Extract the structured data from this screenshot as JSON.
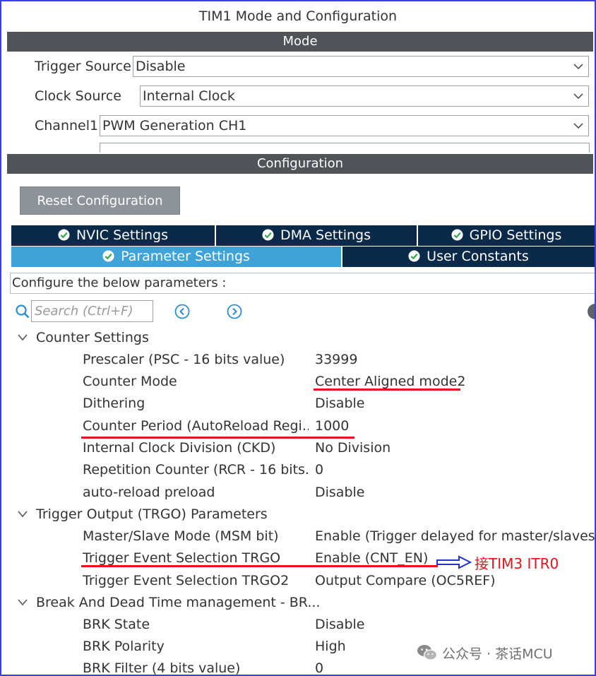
{
  "window": {
    "title": "TIM1 Mode and Configuration"
  },
  "mode": {
    "header": "Mode",
    "fields": [
      {
        "label": "Trigger Source",
        "value": "Disable"
      },
      {
        "label": "Clock Source",
        "value": "Internal Clock"
      },
      {
        "label": "Channel1",
        "value": "PWM Generation CH1"
      }
    ]
  },
  "configuration": {
    "header": "Configuration",
    "reset_button": "Reset Configuration",
    "tabs_row1": [
      "NVIC Settings",
      "DMA Settings",
      "GPIO Settings"
    ],
    "tabs_row2": [
      "Parameter Settings",
      "User Constants"
    ],
    "active_tab": "Parameter Settings",
    "hint": "Configure the below parameters :",
    "search_placeholder": "Search (Ctrl+F)"
  },
  "groups": [
    {
      "title": "Counter Settings",
      "params": [
        {
          "name": "Prescaler (PSC - 16 bits value)",
          "value": "33999"
        },
        {
          "name": "Counter Mode",
          "value": "Center Aligned mode2"
        },
        {
          "name": "Dithering",
          "value": "Disable"
        },
        {
          "name": "Counter Period (AutoReload Regi...",
          "value": "1000"
        },
        {
          "name": "Internal Clock Division (CKD)",
          "value": "No Division"
        },
        {
          "name": "Repetition Counter (RCR - 16 bits...",
          "value": "0"
        },
        {
          "name": "auto-reload preload",
          "value": "Disable"
        }
      ]
    },
    {
      "title": "Trigger Output (TRGO) Parameters",
      "params": [
        {
          "name": "Master/Slave Mode (MSM bit)",
          "value": "Enable (Trigger delayed for master/slaves si"
        },
        {
          "name": "Trigger Event Selection TRGO",
          "value": "Enable (CNT_EN)"
        },
        {
          "name": "Trigger Event Selection TRGO2",
          "value": "Output Compare (OC5REF)"
        }
      ]
    },
    {
      "title": "Break And Dead Time management - BR...",
      "params": [
        {
          "name": "BRK State",
          "value": "Disable"
        },
        {
          "name": "BRK Polarity",
          "value": "High"
        },
        {
          "name": "BRK Filter (4 bits value)",
          "value": "0"
        }
      ]
    }
  ],
  "annotation": {
    "text": "接TIM3 ITR0",
    "color": "#e8131b",
    "arrow_color": "#2433c8"
  },
  "watermark": {
    "text": "公众号 · 茶话MCU"
  },
  "colors": {
    "section_bar": "#505458",
    "tab_dark": "#0b2a4a",
    "tab_active": "#3fa3d8",
    "reset_button": "#8d9399",
    "highlight_red": "#e8131b",
    "frame_border": "#3b3ef0"
  },
  "icons": {
    "dropdown": "chevron-down-icon",
    "tab_status": "check-circle-icon",
    "search": "search-icon",
    "nav_prev": "circle-arrow-left-icon",
    "nav_next": "circle-arrow-right-icon",
    "group_toggle": "chevron-down-icon",
    "annotation": "hollow-arrow-right-icon",
    "watermark": "wechat-icon"
  }
}
